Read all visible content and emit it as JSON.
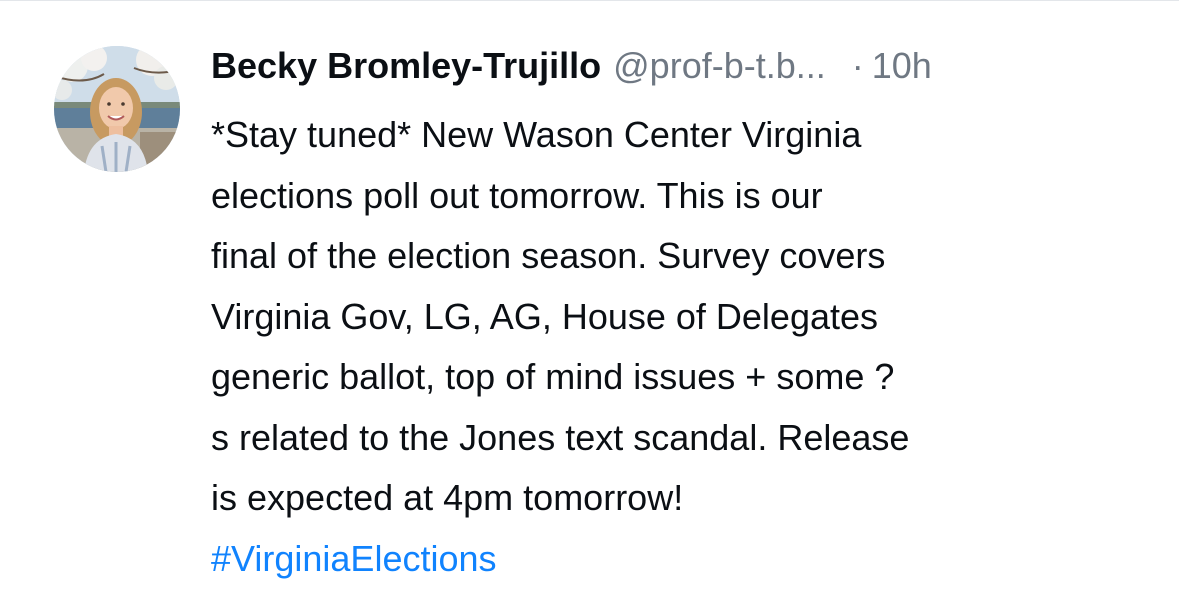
{
  "post": {
    "author": {
      "display_name": "Becky Bromley-Trujillo",
      "handle": "@prof-b-t.b...",
      "avatar_icon": "avatar-photo-icon"
    },
    "separator": "·",
    "time": "10h",
    "body_lines": [
      "*Stay tuned* New Wason Center Virginia",
      "elections poll out tomorrow. This is our",
      "final of the election season. Survey covers",
      "Virginia Gov, LG, AG, House of Delegates",
      "generic ballot, top of mind issues + some ?",
      "s related to the Jones text scandal. Release",
      "is expected at 4pm tomorrow!"
    ],
    "hashtag": "#VirginiaElections"
  },
  "colors": {
    "text": "#0b0f14",
    "muted": "#6f7883",
    "link": "#1083fe",
    "divider": "#e3e6ea"
  }
}
